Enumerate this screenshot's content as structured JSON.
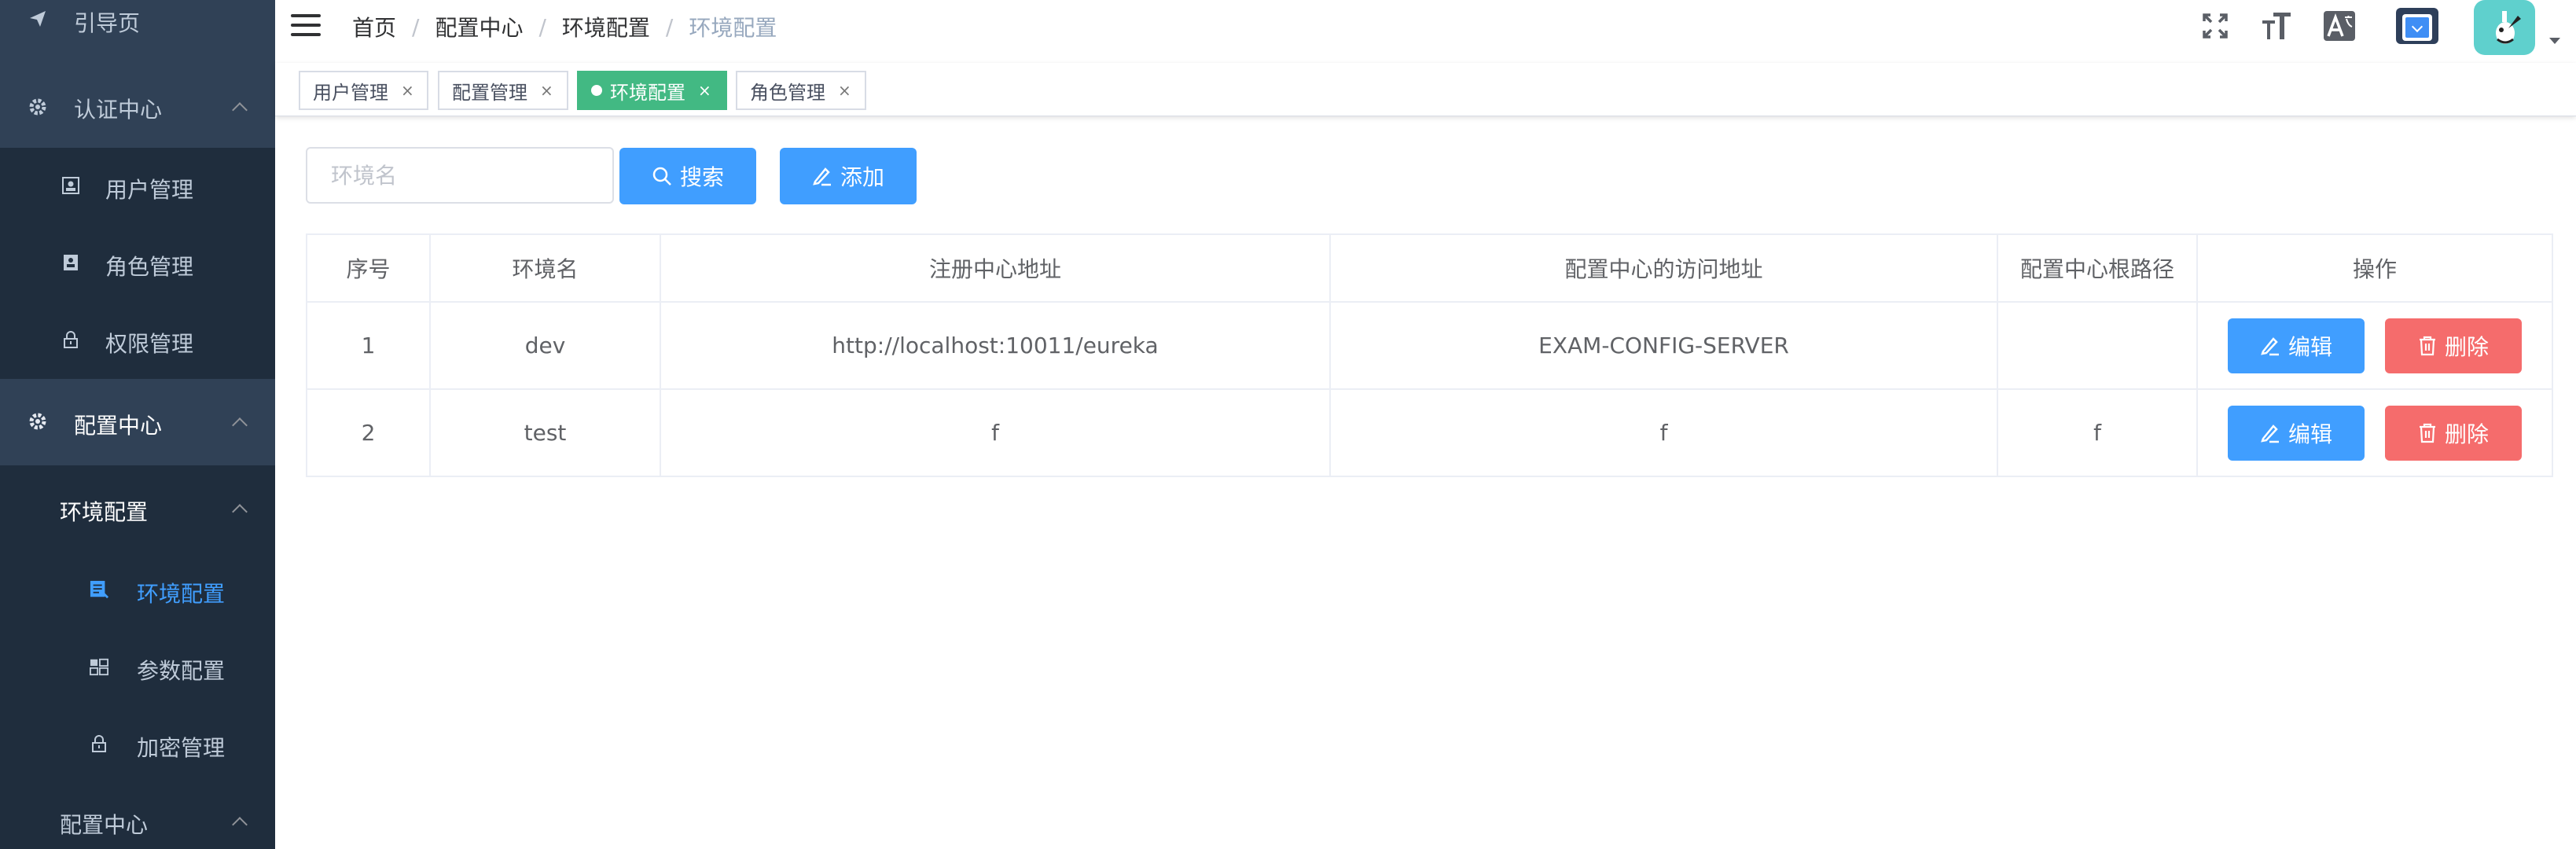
{
  "sidebar": {
    "items": [
      {
        "label": "引导页",
        "icon": "paper-plane-icon"
      },
      {
        "label": "认证中心",
        "icon": "gear-icon"
      },
      {
        "label": "用户管理",
        "icon": "user-card-icon"
      },
      {
        "label": "角色管理",
        "icon": "role-card-icon"
      },
      {
        "label": "权限管理",
        "icon": "lock-icon"
      },
      {
        "label": "配置中心",
        "icon": "gear-icon"
      },
      {
        "label": "环境配置"
      },
      {
        "label": "环境配置",
        "icon": "document-edit-icon",
        "active": true
      },
      {
        "label": "参数配置",
        "icon": "grid-icon"
      },
      {
        "label": "加密管理",
        "icon": "lock-icon"
      },
      {
        "label": "配置中心"
      }
    ]
  },
  "navbar": {
    "breadcrumb": [
      "首页",
      "配置中心",
      "环境配置",
      "环境配置"
    ],
    "separator": "/",
    "icons": [
      "fullscreen-icon",
      "font-size-icon",
      "translate-icon",
      "language-select-icon",
      "avatar-icon"
    ]
  },
  "tags": [
    {
      "label": "用户管理",
      "close": "×",
      "active": false
    },
    {
      "label": "配置管理",
      "close": "×",
      "active": false
    },
    {
      "label": "环境配置",
      "close": "×",
      "active": true
    },
    {
      "label": "角色管理",
      "close": "×",
      "active": false
    }
  ],
  "filter": {
    "placeholder": "环境名",
    "value": "",
    "search_label": "搜索",
    "add_label": "添加"
  },
  "table": {
    "columns": [
      "序号",
      "环境名",
      "注册中心地址",
      "配置中心的访问地址",
      "配置中心根路径",
      "操作"
    ],
    "rows": [
      {
        "index": "1",
        "name": "dev",
        "registry": "http://localhost:10011/eureka",
        "config_url": "EXAM-CONFIG-SERVER",
        "root_path": ""
      },
      {
        "index": "2",
        "name": "test",
        "registry": "f",
        "config_url": "f",
        "root_path": "f"
      }
    ],
    "edit_label": "编辑",
    "delete_label": "删除"
  },
  "colors": {
    "sidebar_bg": "#304156",
    "submenu_bg": "#1f2d3d",
    "primary": "#409eff",
    "danger": "#f56c6c",
    "tag_active": "#42b983"
  }
}
